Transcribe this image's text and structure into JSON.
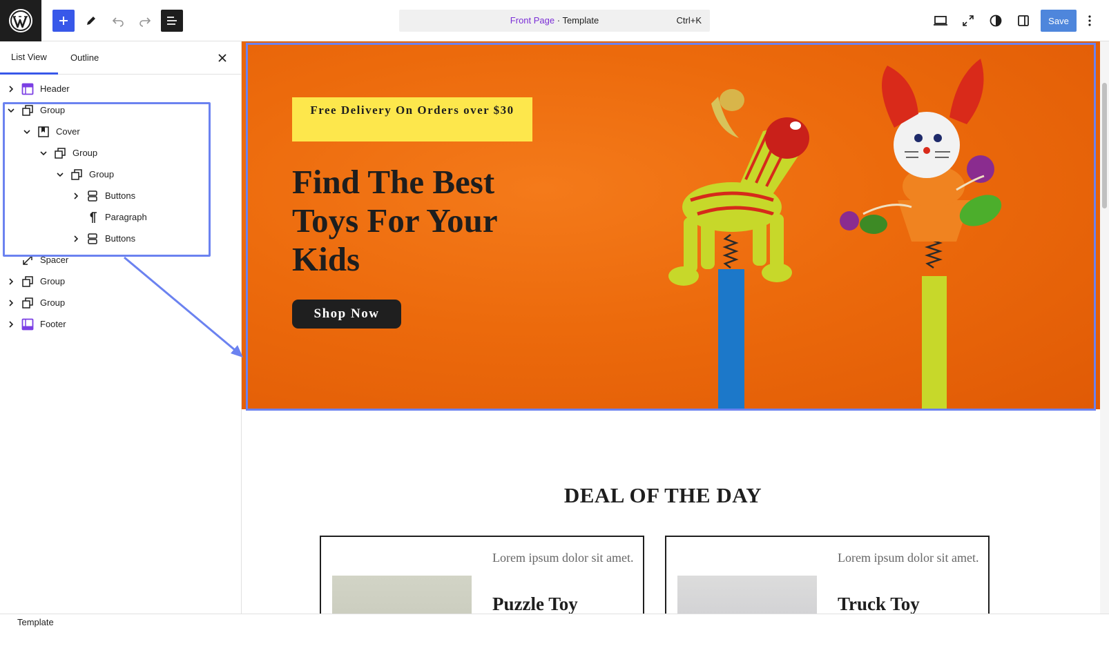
{
  "topbar": {
    "command": {
      "page": "Front Page",
      "separator": " · ",
      "type": "Template",
      "shortcut": "Ctrl+K"
    },
    "save_label": "Save"
  },
  "sidebar": {
    "tabs": [
      "List View",
      "Outline"
    ],
    "tree": [
      {
        "label": "Header",
        "icon": "template-part-icon"
      },
      {
        "label": "Group",
        "icon": "group-icon"
      },
      {
        "label": "Cover",
        "icon": "cover-icon"
      },
      {
        "label": "Group",
        "icon": "group-icon"
      },
      {
        "label": "Group",
        "icon": "group-icon"
      },
      {
        "label": "Buttons",
        "icon": "buttons-icon"
      },
      {
        "label": "Paragraph",
        "icon": "paragraph-icon"
      },
      {
        "label": "Buttons",
        "icon": "buttons-icon"
      },
      {
        "label": "Spacer",
        "icon": "spacer-icon"
      },
      {
        "label": "Group",
        "icon": "group-icon"
      },
      {
        "label": "Group",
        "icon": "group-icon"
      },
      {
        "label": "Footer",
        "icon": "template-part-icon"
      }
    ]
  },
  "canvas": {
    "promo": "Free Delivery On Orders over $30",
    "hero_title": "Find The Best Toys For Your Kids",
    "shop_button": "Shop Now",
    "deal_title": "DEAL OF THE DAY",
    "cards": [
      {
        "desc": "Lorem ipsum dolor sit amet.",
        "name": "Puzzle Toy"
      },
      {
        "desc": "Lorem ipsum dolor sit amet.",
        "name": "Truck Toy"
      }
    ]
  },
  "statusbar": {
    "label": "Template"
  },
  "colors": {
    "accent": "#3858e9",
    "selection": "#6b82f0",
    "cover": "#ec6a0c",
    "promo": "#fde74c"
  }
}
